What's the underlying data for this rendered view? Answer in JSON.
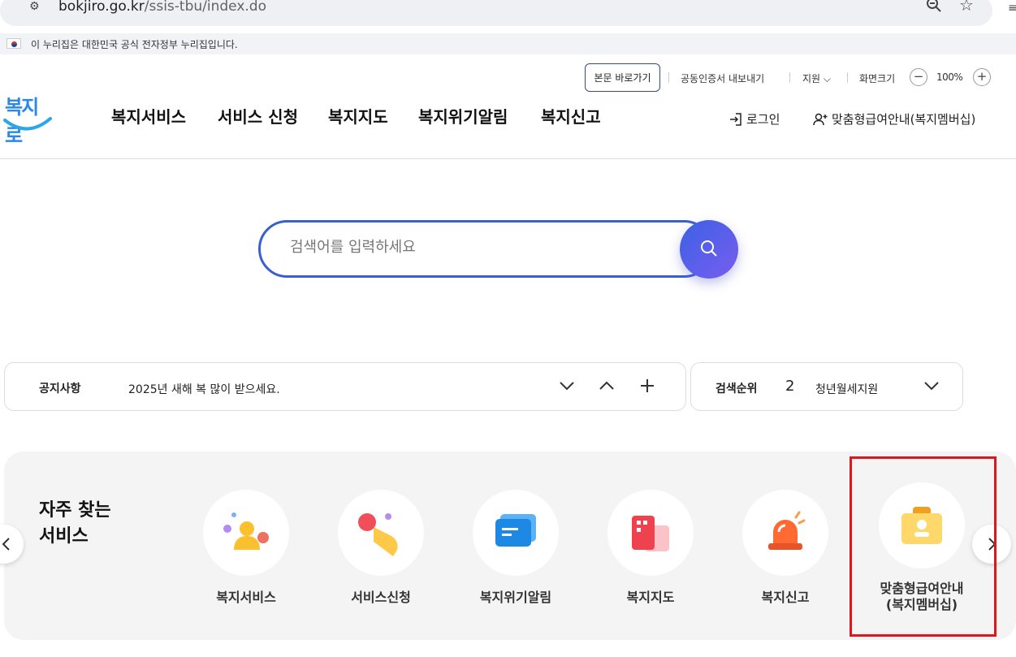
{
  "browser": {
    "url_domain": "bokjiro.go.kr",
    "url_path": "/ssis-tbu/index.do"
  },
  "gov_banner": "이 누리집은 대한민국 공식 전자정부 누리집입니다.",
  "utility": {
    "skip": "본문 바로가기",
    "cert": "공동인증서 내보내기",
    "support": "지원",
    "screen_size": "화면크기",
    "zoom": "100%"
  },
  "logo": "복지로",
  "gnb": [
    "복지서비스",
    "서비스 신청",
    "복지지도",
    "복지위기알림",
    "복지신고"
  ],
  "header": {
    "login": "로그인",
    "member": "맞춤형급여안내(복지멤버십)"
  },
  "search": {
    "placeholder": "검색어를 입력하세요"
  },
  "notice": {
    "label": "공지사항",
    "text": "2025년 새해 복 많이 받으세요."
  },
  "rank": {
    "label": "검색순위",
    "number": "2",
    "text": "청년월세지원"
  },
  "services": {
    "title_line1": "자주 찾는",
    "title_line2": "서비스",
    "items": [
      {
        "label": "복지서비스",
        "icon": "people-icon"
      },
      {
        "label": "서비스신청",
        "icon": "hand-click-icon"
      },
      {
        "label": "복지위기알림",
        "icon": "chat-alert-icon"
      },
      {
        "label": "복지지도",
        "icon": "map-building-icon"
      },
      {
        "label": "복지신고",
        "icon": "siren-icon"
      },
      {
        "label": "맞춤형급여안내",
        "label2": "(복지멤버십)",
        "icon": "membership-card-icon"
      }
    ]
  },
  "colors": {
    "accent": "#3b5fd0",
    "highlight": "#e0161d"
  }
}
